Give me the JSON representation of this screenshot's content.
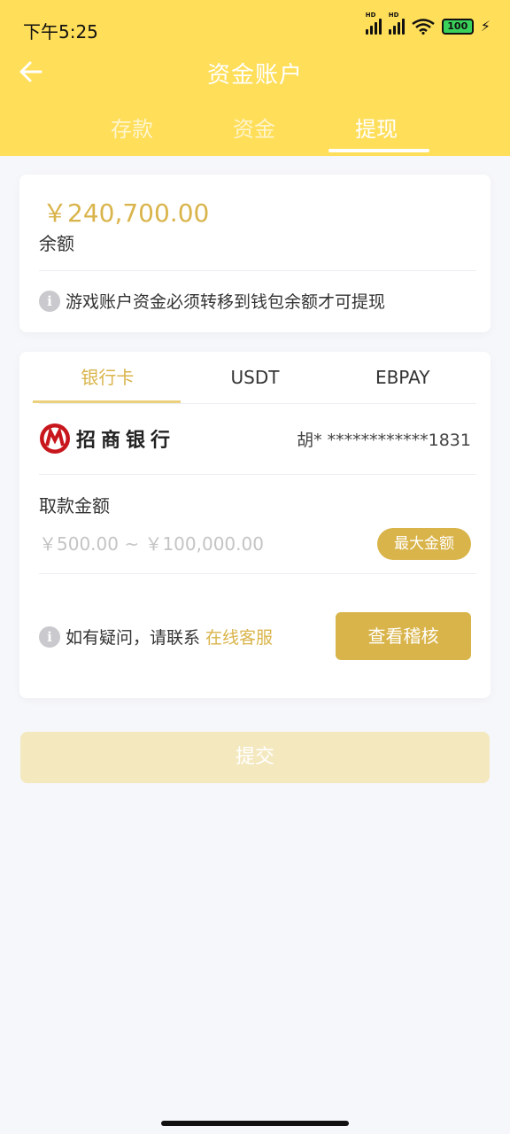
{
  "status_bar": {
    "time": "下午5:25",
    "signal_label": "HD",
    "battery": "100"
  },
  "header": {
    "title": "资金账户",
    "tabs": [
      {
        "label": "存款",
        "active": false
      },
      {
        "label": "资金",
        "active": false
      },
      {
        "label": "提现",
        "active": true
      }
    ]
  },
  "balance": {
    "amount": "￥240,700.00",
    "label": "余额",
    "notice": "游戏账户资金必须转移到钱包余额才可提现"
  },
  "withdraw": {
    "method_tabs": [
      {
        "label": "银行卡",
        "active": true
      },
      {
        "label": "USDT",
        "active": false
      },
      {
        "label": "EBPAY",
        "active": false
      }
    ],
    "bank_name": "招商银行",
    "card_number": "胡* ************1831",
    "amount_label": "取款金额",
    "amount_placeholder": "￥500.00 ~ ￥100,000.00",
    "amount_value": "",
    "max_button": "最大金额",
    "help_text": "如有疑问，请联系",
    "help_link": "在线客服",
    "review_button": "查看稽核"
  },
  "submit_button": "提交",
  "colors": {
    "header": "#ffde59",
    "accent": "#d9b44a",
    "bank_red": "#c8161d"
  }
}
